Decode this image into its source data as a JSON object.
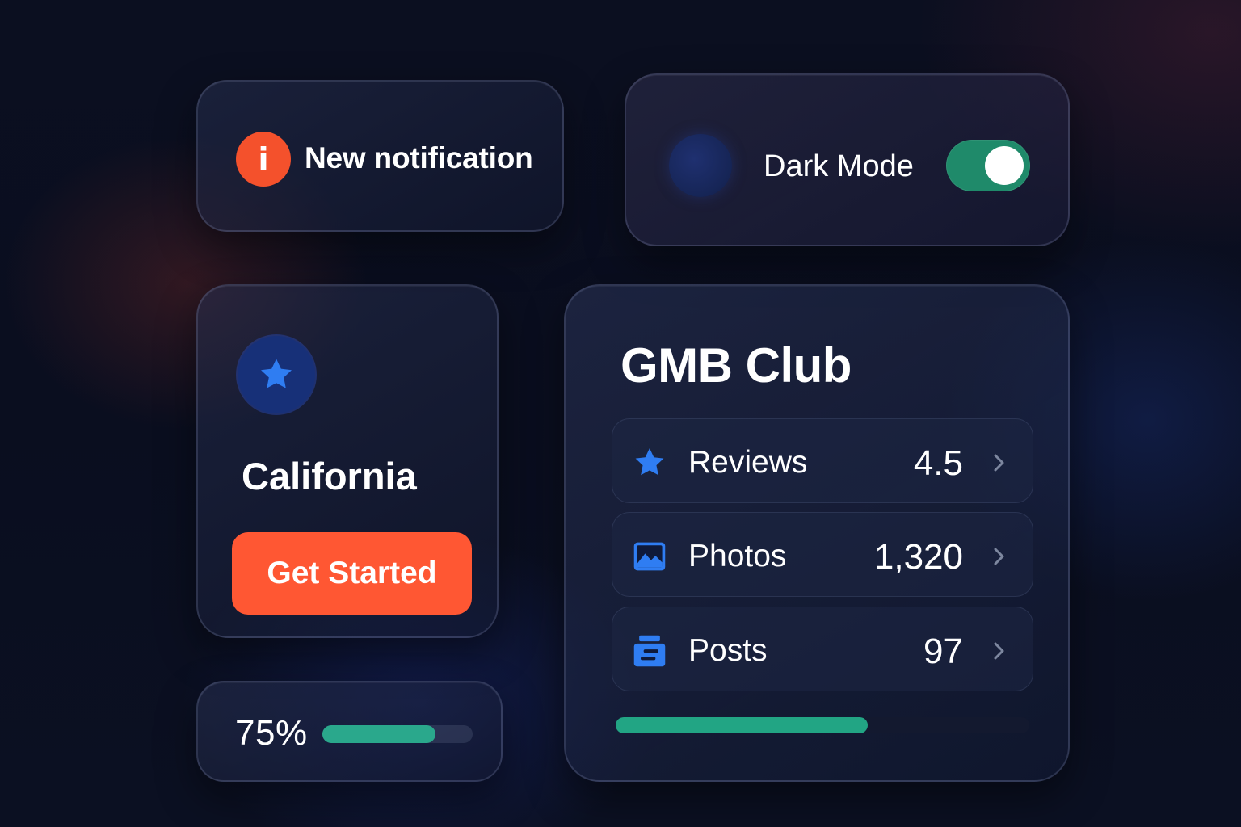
{
  "notification": {
    "icon": "info-icon",
    "icon_glyph": "i",
    "label": "New notification",
    "accent_color": "#f4512c"
  },
  "dark_mode": {
    "icon": "moon-icon",
    "label": "Dark Mode",
    "enabled": true,
    "toggle_color": "#1f8a6a"
  },
  "location": {
    "icon": "star-icon",
    "name": "California",
    "cta_label": "Get Started",
    "cta_color": "#ff5733"
  },
  "progress": {
    "label": "75%",
    "value": 0.75,
    "bar_color": "#2aa88c"
  },
  "gmb": {
    "title": "GMB Club",
    "stats": [
      {
        "icon": "star-icon",
        "label": "Reviews",
        "value": "4.5"
      },
      {
        "icon": "image-icon",
        "label": "Photos",
        "value": "1,320"
      },
      {
        "icon": "posts-icon",
        "label": "Posts",
        "value": "97"
      }
    ],
    "progress_value": 0.61,
    "bar_color": "#22a584",
    "icon_color": "#2f7df2"
  }
}
